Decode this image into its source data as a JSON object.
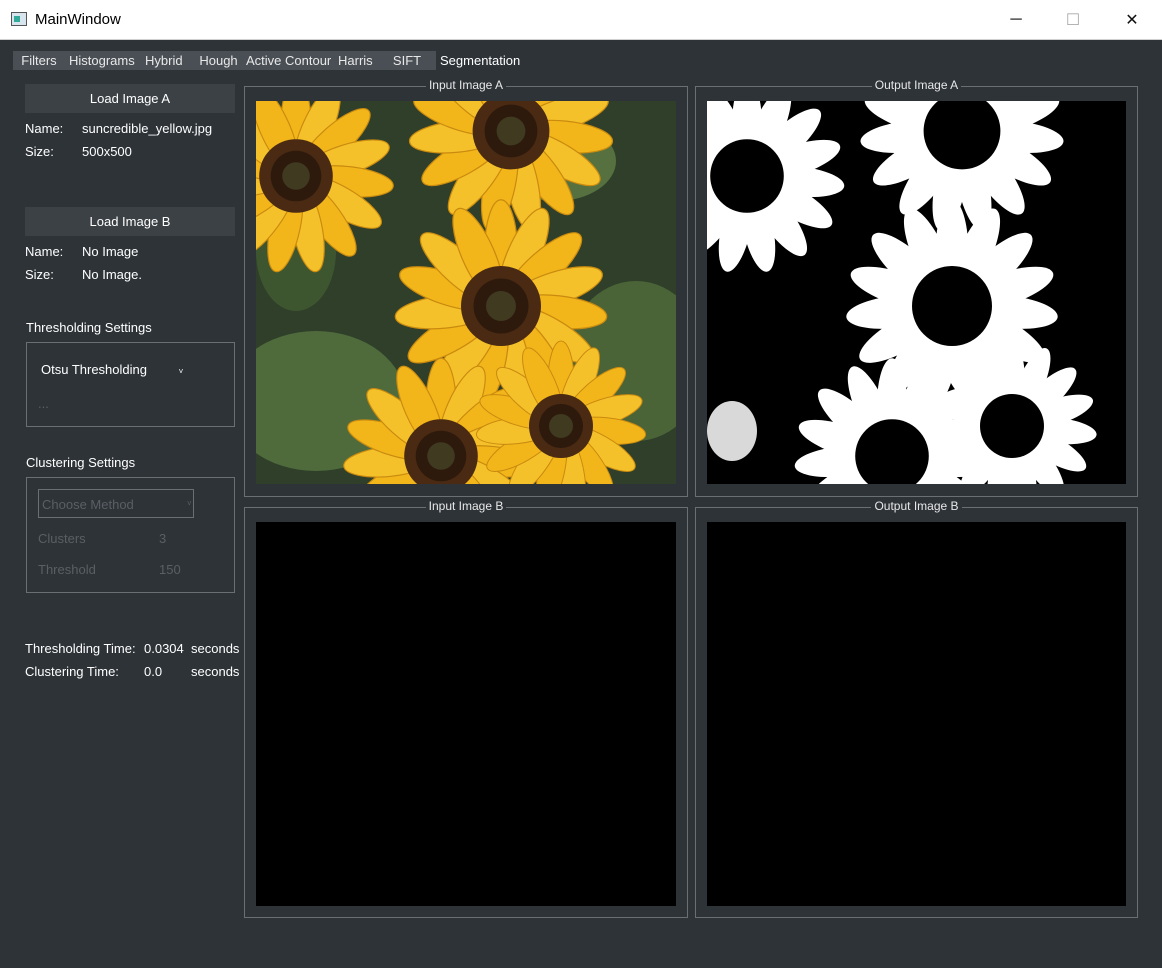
{
  "window": {
    "title": "MainWindow",
    "controls": {
      "minimize": "─",
      "maximize": "☐",
      "close": "✕"
    }
  },
  "menu": {
    "tabs": [
      "Filters",
      "Histograms",
      "Hybrid",
      "Hough",
      "Active Contour",
      "Harris",
      "SIFT",
      "Segmentation"
    ],
    "active": "Segmentation"
  },
  "sidebar": {
    "image_a": {
      "button": "Load Image A",
      "name_label": "Name:",
      "name_value": "suncredible_yellow.jpg",
      "size_label": "Size:",
      "size_value": "500x500"
    },
    "image_b": {
      "button": "Load Image B",
      "name_label": "Name:",
      "name_value": "No Image",
      "size_label": "Size:",
      "size_value": "No Image."
    },
    "thresholding": {
      "title": "Thresholding Settings",
      "method": "Otsu Thresholding",
      "extra": "..."
    },
    "clustering": {
      "title": "Clustering Settings",
      "method_placeholder": "Choose Method",
      "clusters_label": "Clusters",
      "clusters_value": "3",
      "threshold_label": "Threshold",
      "threshold_value": "150"
    },
    "timing": {
      "thresholding_label": "Thresholding Time:",
      "thresholding_value": "0.0304",
      "thresholding_unit": "seconds",
      "clustering_label": "Clustering Time:",
      "clustering_value": "0.0",
      "clustering_unit": "seconds"
    }
  },
  "panels": {
    "input_a": "Input Image A",
    "output_a": "Output Image A",
    "input_b": "Input Image B",
    "output_b": "Output Image B"
  },
  "colors": {
    "background": "#2e3338",
    "button": "#3c4146",
    "tab": "#4a4f55",
    "border": "#6a6f74",
    "petal": "#f2b51a",
    "leaf": "#4f6b3c"
  }
}
